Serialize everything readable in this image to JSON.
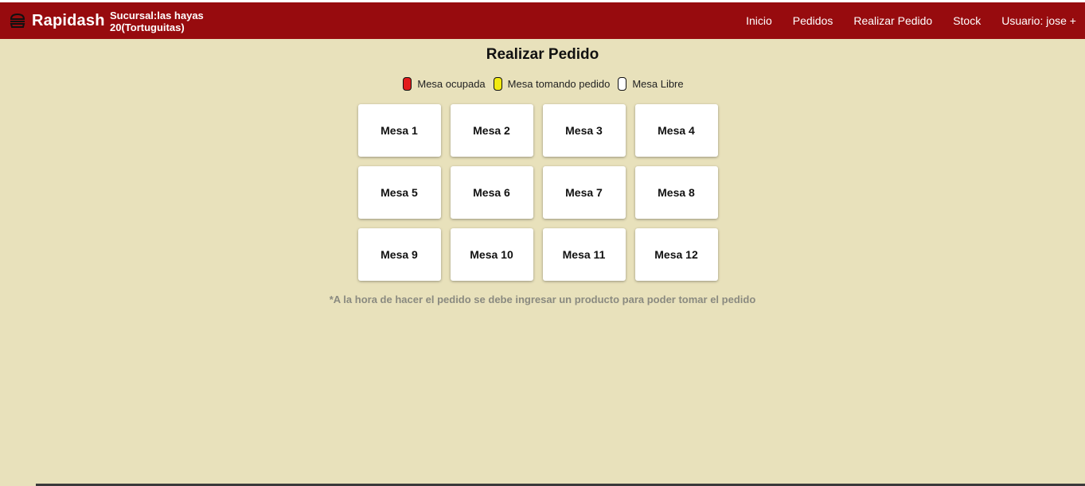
{
  "navbar": {
    "brand": "Rapidash",
    "brand_icon": "burger-icon",
    "branch": "Sucursal:las hayas 20(Tortuguitas)",
    "links": [
      "Inicio",
      "Pedidos",
      "Realizar Pedido",
      "Stock"
    ],
    "user": "Usuario: jose +",
    "bg_color": "#970b0e"
  },
  "page": {
    "title": "Realizar Pedido",
    "background": "#e8e1bb"
  },
  "legend": [
    {
      "label": "Mesa ocupada",
      "color": "#e21b1b"
    },
    {
      "label": "Mesa tomando pedido",
      "color": "#f2ea11"
    },
    {
      "label": "Mesa Libre",
      "color": "#ffffff"
    }
  ],
  "tables": [
    "Mesa 1",
    "Mesa 2",
    "Mesa 3",
    "Mesa 4",
    "Mesa 5",
    "Mesa 6",
    "Mesa 7",
    "Mesa 8",
    "Mesa 9",
    "Mesa 10",
    "Mesa 11",
    "Mesa 12"
  ],
  "note": "*A la hora de hacer el pedido se debe ingresar un producto para poder tomar el pedido"
}
